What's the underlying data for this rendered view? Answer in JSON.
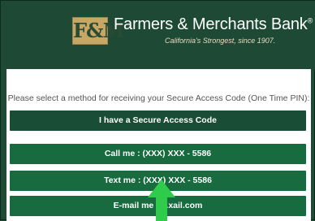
{
  "header": {
    "logo_text": "F&M",
    "bank_name": "Farmers & Merchants Bank",
    "trademark": "®",
    "tagline": "California's Strongest, since 1907."
  },
  "main": {
    "instruction": "Please select a method for receiving your Secure Access Code (One Time PIN):",
    "buttons": [
      {
        "label": "I have a Secure Access Code"
      },
      {
        "label": "Call me : (XXX) XXX - 5586"
      },
      {
        "label": "Text me : (XXX) XXX - 5586"
      },
      {
        "label": "E-mail me : ...xail.com"
      }
    ]
  },
  "colors": {
    "header_green": "#1e4a35",
    "button_green": "#176b3e",
    "button_dark": "#1a4d35",
    "arrow_green": "#2ecc4a",
    "logo_gold": "#c7a765"
  },
  "icons": {
    "pointer": "green-up-arrow-icon"
  }
}
